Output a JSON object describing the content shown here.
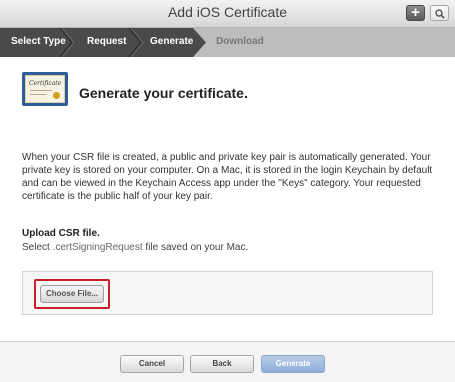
{
  "window": {
    "title": "Add iOS Certificate",
    "add_icon": "plus-icon",
    "search_icon": "search-icon"
  },
  "steps": [
    {
      "label": "Select Type",
      "state": "done"
    },
    {
      "label": "Request",
      "state": "done"
    },
    {
      "label": "Generate",
      "state": "current"
    },
    {
      "label": "Download",
      "state": "pending"
    }
  ],
  "main": {
    "certificate_icon": "certificate-icon",
    "certificate_icon_text": "Certificate",
    "heading": "Generate your certificate.",
    "description": "When your CSR file is created, a public and private key pair is automatically generated. Your private key is stored on your computer. On a Mac, it is stored in the login Keychain by default and can be viewed in the Keychain Access app under the \"Keys\" category. Your requested certificate is the public half of your key pair.",
    "upload_title": "Upload CSR file.",
    "upload_desc_prefix": "Select ",
    "upload_desc_code": ".certSigningRequest",
    "upload_desc_suffix": " file saved on your Mac.",
    "choose_file_label": "Choose File..."
  },
  "footer": {
    "cancel_label": "Cancel",
    "back_label": "Back",
    "generate_label": "Generate"
  },
  "colors": {
    "steps_active": "#4a4a4a",
    "steps_inactive": "#bdbdbd",
    "highlight": "#c8202a",
    "generate_button": "#8fb0db"
  }
}
